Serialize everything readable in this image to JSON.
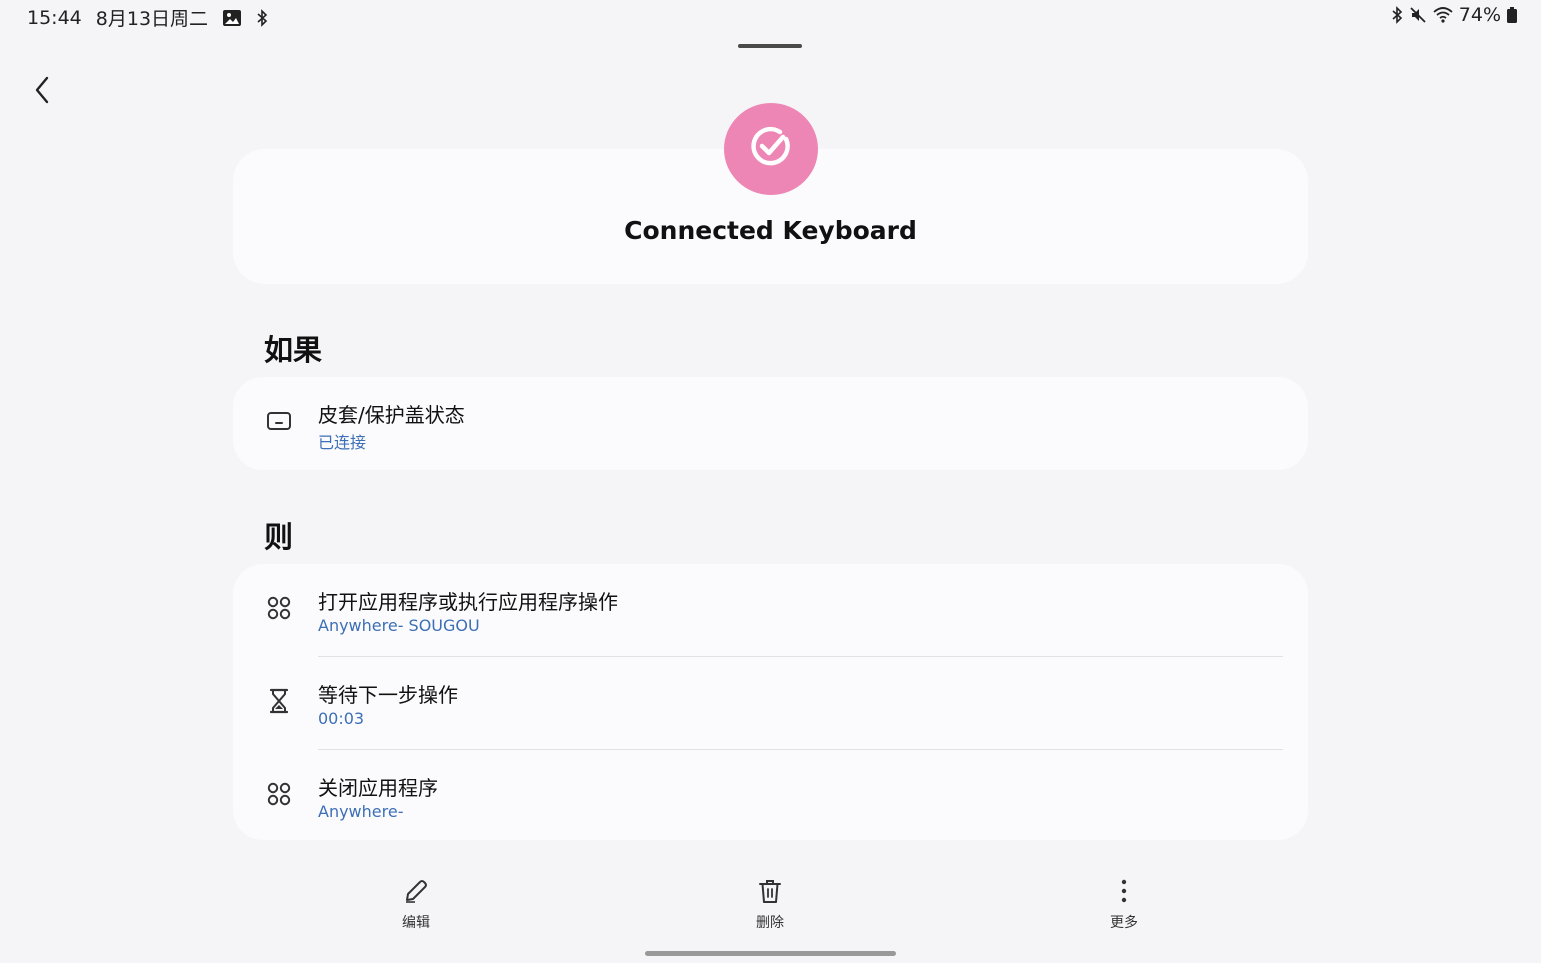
{
  "status_bar": {
    "time": "15:44",
    "date": "8月13日周二",
    "left_icons": [
      "image-icon",
      "bluetooth-icon"
    ],
    "right_icons": [
      "bluetooth-icon",
      "mute-icon",
      "wifi-icon"
    ],
    "battery": "74%"
  },
  "header": {
    "icon": "check-circle-icon",
    "icon_color": "#ee86b5",
    "title": "Connected Keyboard"
  },
  "if_section": {
    "title": "如果",
    "items": [
      {
        "icon": "cover-icon",
        "title": "皮套/保护盖状态",
        "subtitle": "已连接"
      }
    ]
  },
  "then_section": {
    "title": "则",
    "items": [
      {
        "icon": "apps-icon",
        "title": "打开应用程序或执行应用程序操作",
        "subtitle": "Anywhere- SOUGOU"
      },
      {
        "icon": "hourglass-icon",
        "title": "等待下一步操作",
        "subtitle": "00:03"
      },
      {
        "icon": "apps-icon",
        "title": "关闭应用程序",
        "subtitle": "Anywhere-"
      }
    ]
  },
  "toolbar": {
    "edit_label": "编辑",
    "delete_label": "删除",
    "more_label": "更多"
  },
  "colors": {
    "accent_link": "#3d6fb6",
    "background": "#f5f5f7",
    "card": "#fbfbfd"
  }
}
